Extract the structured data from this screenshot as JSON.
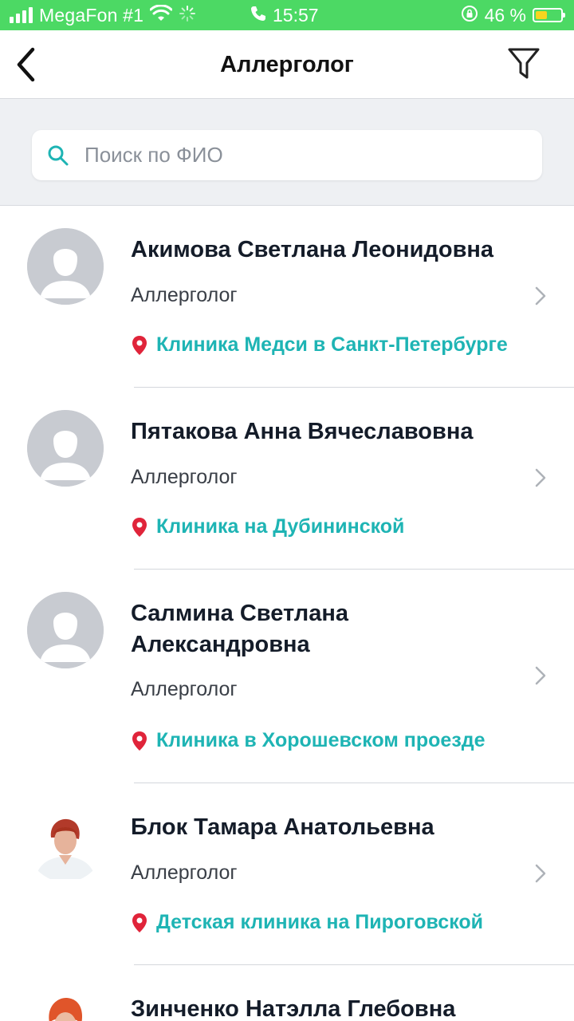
{
  "status_bar": {
    "carrier": "MegaFon #1",
    "time": "15:57",
    "battery_percent": "46 %",
    "battery_level": 0.46,
    "icons": [
      "signal-icon",
      "wifi-icon",
      "activity-spinner-icon",
      "phone-icon",
      "orientation-lock-icon",
      "battery-charging-icon"
    ]
  },
  "nav": {
    "title": "Аллерголог",
    "back_icon": "chevron-left-icon",
    "filter_icon": "filter-icon"
  },
  "search": {
    "placeholder": "Поиск по ФИО",
    "value": "",
    "icon": "search-icon"
  },
  "colors": {
    "status_bar": "#4cd964",
    "accent": "#1eb4b4",
    "pin": "#e0243a"
  },
  "doctors": [
    {
      "name": "Акимова Светлана Леонидовна",
      "specialty": "Аллерголог",
      "clinic": "Клиника Медси в Санкт-Петербурге",
      "avatar": "placeholder-avatar-icon"
    },
    {
      "name": "Пятакова Анна Вячеславовна",
      "specialty": "Аллерголог",
      "clinic": "Клиника на Дубининской",
      "avatar": "placeholder-avatar-icon"
    },
    {
      "name": "Салмина Светлана Александровна",
      "specialty": "Аллерголог",
      "clinic": "Клиника в Хорошевском проезде",
      "avatar": "placeholder-avatar-icon"
    },
    {
      "name": "Блок Тамара Анатольевна",
      "specialty": "Аллерголог",
      "clinic": "Детская клиника на Пироговской",
      "avatar": "doctor-photo"
    },
    {
      "name": "Зинченко Натэлла Глебовна",
      "specialty": "",
      "clinic": "",
      "avatar": "doctor-photo"
    }
  ]
}
